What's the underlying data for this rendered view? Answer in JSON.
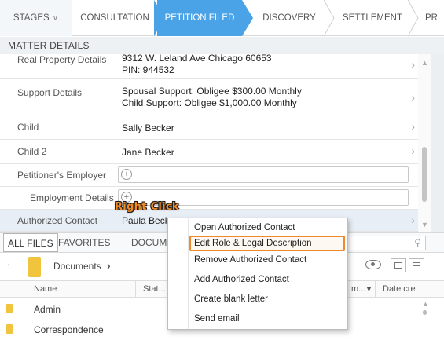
{
  "stages": {
    "dropdown_label": "STAGES",
    "items": [
      {
        "label": "CONSULTATION"
      },
      {
        "label": "PETITION FILED"
      },
      {
        "label": "DISCOVERY"
      },
      {
        "label": "SETTLEMENT"
      },
      {
        "label": "PR"
      }
    ],
    "active_index": 1,
    "active_color": "#4aa3e6"
  },
  "matter_details": {
    "header": "MATTER DETAILS",
    "rows": [
      {
        "label": "Real Property Details",
        "value_line1": "9312 W. Leland Ave Chicago 60653",
        "value_line2": "PIN: 944532"
      },
      {
        "label": "Support Details",
        "value_line1": "Spousal Support: Obligee $300.00 Monthly",
        "value_line2": "Child Support: Obligee $1,000.00 Monthly"
      },
      {
        "label": "Child",
        "value": "Sally Becker"
      },
      {
        "label": "Child 2",
        "value": "Jane Becker"
      },
      {
        "label": "Petitioner's Employer"
      },
      {
        "label": "Employment Details"
      },
      {
        "label": "Authorized Contact",
        "value": "Paula Beck"
      }
    ]
  },
  "files": {
    "tabs": [
      "ALL FILES",
      "FAVORITES",
      "DOCUM"
    ],
    "breadcrumb": "Documents",
    "columns": {
      "name": "Name",
      "status": "Stat...",
      "modified": "m...",
      "date": "Date cre"
    },
    "rows": [
      {
        "name": "Admin"
      },
      {
        "name": "Correspondence"
      }
    ]
  },
  "context_menu": {
    "items": [
      "Open Authorized Contact",
      "Edit Role & Legal Description",
      "Remove Authorized Contact",
      "Add Authorized Contact",
      "Create blank letter",
      "Send email"
    ],
    "highlighted_index": 1,
    "highlight_color": "#ee8a2d"
  },
  "annotation": {
    "text": "Right Click",
    "color": "#f08a24"
  },
  "icons": {
    "stages_dropdown": "chevron-down-icon",
    "row_chevron": "chevron-right-icon",
    "add": "plus-circle-icon",
    "up": "arrow-up-icon",
    "folder": "folder-icon",
    "preview": "eye-icon",
    "grid_view": "grid-view-icon",
    "list_view": "list-view-icon",
    "search": "search-icon"
  }
}
